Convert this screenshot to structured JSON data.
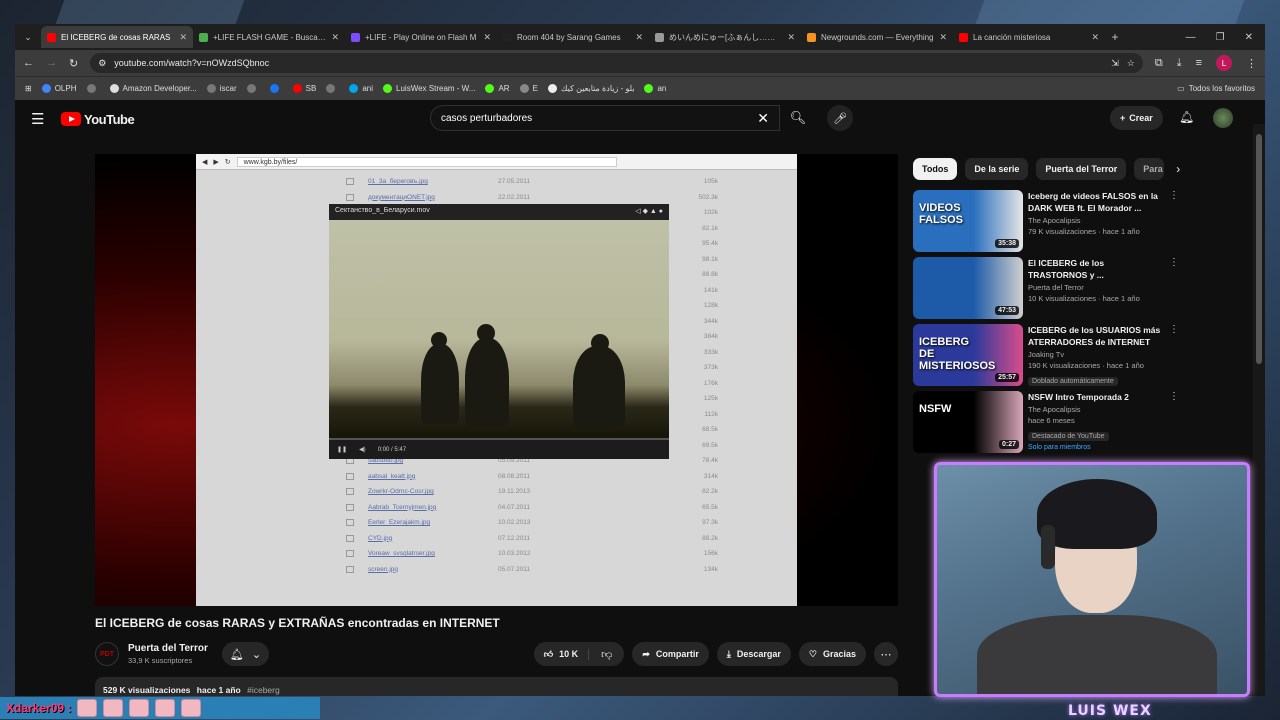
{
  "browser": {
    "tabs": [
      {
        "title": "El ICEBERG de cosas RARAS",
        "color": "#ff0000",
        "active": true
      },
      {
        "title": "+LIFE FLASH GAME - Buscar co",
        "color": "#4caf50"
      },
      {
        "title": "+LIFE - Play Online on Flash M",
        "color": "#7c4dff"
      },
      {
        "title": "Room 404 by Sarang Games",
        "color": "#222222"
      },
      {
        "title": "めいんめにゅー[ふぁんし…あいぐ",
        "color": "#999999"
      },
      {
        "title": "Newgrounds.com — Everything",
        "color": "#f7941d"
      },
      {
        "title": "La canción misteriosa",
        "color": "#ff0000"
      }
    ],
    "url": "youtube.com/watch?v=nOWzdSQbnoc",
    "bookmarks": [
      {
        "label": "OLPH",
        "color": "#4285f4"
      },
      {
        "label": "",
        "color": "#777777"
      },
      {
        "label": "Amazon Developer...",
        "color": "#dddddd"
      },
      {
        "label": "iscar",
        "color": "#777777"
      },
      {
        "label": "",
        "color": "#777777"
      },
      {
        "label": "",
        "color": "#1877f2"
      },
      {
        "label": "SB",
        "color": "#ff0000"
      },
      {
        "label": "",
        "color": "#777777"
      },
      {
        "label": "ani",
        "color": "#00a4ef"
      },
      {
        "label": "LuisWex Stream - W...",
        "color": "#53fc18"
      },
      {
        "label": "AR",
        "color": "#53fc18"
      },
      {
        "label": "E",
        "color": "#888888"
      },
      {
        "label": "بلو - زيادة متابعين كيك",
        "color": "#eeeeee"
      },
      {
        "label": "an",
        "color": "#53fc18"
      }
    ],
    "bookmarks_right": "Todos los favoritos",
    "profile_initial": "L"
  },
  "youtube": {
    "logo_text": "YouTube",
    "search_value": "casos perturbadores",
    "create_label": "Crear",
    "video": {
      "title": "El ICEBERG de cosas RARAS y EXTRAÑAS encontradas en INTERNET",
      "channel": "Puerta del Terror",
      "channel_avatar": "PDT",
      "subscribers": "33,9 K suscriptores",
      "likes": "10 K",
      "share_label": "Compartir",
      "download_label": "Descargar",
      "thanks_label": "Gracias",
      "views": "529 K visualizaciones",
      "age": "hace 1 año",
      "hashtag": "#iceberg"
    },
    "inner_screen": {
      "url": "www.kgb.by/files/",
      "video_filename": "Сектанство_в_Беларуси.mov",
      "video_time": "0:00 / 5:47",
      "files": [
        {
          "name": "01_3a_береговъ.jpg",
          "date": "27.05.2011",
          "size": "105k"
        },
        {
          "name": "документациONET.jpg",
          "date": "22.02.2011",
          "size": "502.3k"
        },
        {
          "name": "",
          "date": "",
          "size": "102k"
        },
        {
          "name": "",
          "date": "",
          "size": "82.1k"
        },
        {
          "name": "",
          "date": "",
          "size": "95.4k"
        },
        {
          "name": "",
          "date": "",
          "size": "98.1k"
        },
        {
          "name": "",
          "date": "",
          "size": "88.8k"
        },
        {
          "name": "",
          "date": "",
          "size": "141k"
        },
        {
          "name": "",
          "date": "",
          "size": "128k"
        },
        {
          "name": "",
          "date": "",
          "size": "344k"
        },
        {
          "name": "",
          "date": "",
          "size": "384k"
        },
        {
          "name": "",
          "date": "",
          "size": "333k"
        },
        {
          "name": "",
          "date": "",
          "size": "373k"
        },
        {
          "name": "",
          "date": "",
          "size": "176k"
        },
        {
          "name": "",
          "date": "",
          "size": "125k"
        },
        {
          "name": "",
          "date": "",
          "size": "112k"
        },
        {
          "name": "",
          "date": "",
          "size": "68.5k"
        },
        {
          "name": "Ekzelr_thdnet.jpg",
          "date": "07.04.2012",
          "size": "69.5k"
        },
        {
          "name": "sabsbeb.jpg",
          "date": "05.09.2011",
          "size": "78.4k"
        },
        {
          "name": "aabsal_keatt.jpg",
          "date": "08.08.2011",
          "size": "314k"
        },
        {
          "name": "Zowrkr-Odrnc-Cosr.jpg",
          "date": "19.11.2013",
          "size": "82.2k"
        },
        {
          "name": "Aabrab_Tcernyjmen.jpg",
          "date": "04.07.2011",
          "size": "65.5k"
        },
        {
          "name": "Eerler_Ezerajakm.jpg",
          "date": "10.02.2013",
          "size": "97.3k"
        },
        {
          "name": "CYD.jpg",
          "date": "07.12.2011",
          "size": "88.2k"
        },
        {
          "name": "Voreaw_svsqlatrser.jpg",
          "date": "10.03.2012",
          "size": "156k"
        },
        {
          "name": "screen.jpg",
          "date": "05.07.2011",
          "size": "134k"
        }
      ]
    },
    "chips": [
      "Todos",
      "De la serie",
      "Puerta del Terror",
      "Para"
    ],
    "recommendations": [
      {
        "title": "Iceberg de videos FALSOS en la DARK WEB ft. El Morador ...",
        "channel": "The Apocalipsis",
        "meta": "79 K visualizaciones · hace 1 año",
        "duration": "35:38",
        "thumb_text": "VIDEOS FALSOS",
        "colors": [
          "#2a6fbd",
          "#e5e5e5"
        ]
      },
      {
        "title": "El ICEBERG de los TRASTORNOS y ...",
        "channel": "Puerta del Terror",
        "meta": "10 K visualizaciones · hace 1 año",
        "duration": "47:53",
        "thumb_text": "",
        "colors": [
          "#1d5aa8",
          "#cfcfcf"
        ]
      },
      {
        "title": "ICEBERG de los USUARIOS más ATERRADORES de INTERNET",
        "channel": "Joaking Tv",
        "meta": "190 K visualizaciones · hace 1 año",
        "duration": "25:57",
        "thumb_text": "ICEBERG DE MISTERIOSOS",
        "badge": "Doblado automáticamente",
        "colors": [
          "#2b3a9a",
          "#d94c8b"
        ]
      },
      {
        "title": "NSFW Intro Temporada 2",
        "channel": "The Apocalipsis",
        "meta": "hace 6 meses",
        "duration": "0:27",
        "thumb_text": "NSFW",
        "badge": "Destacado de YouTube",
        "badge2": "Solo para miembros",
        "colors": [
          "#000000",
          "#d8a6b8"
        ]
      }
    ]
  },
  "overlay": {
    "streamer_name": "LUIS WEX",
    "chat_user": "Xdarker09 :",
    "emote_count": 5,
    "accent": "#c77dff"
  }
}
